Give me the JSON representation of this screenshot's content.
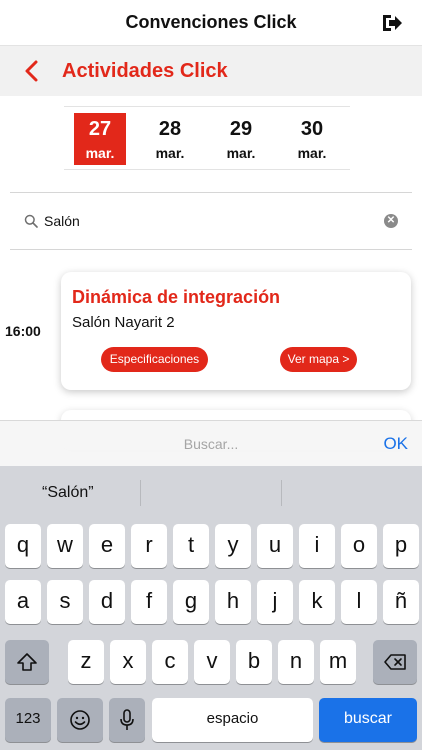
{
  "header": {
    "title": "Convenciones Click",
    "logout_icon": "logout-icon"
  },
  "section": {
    "title": "Actividades Click",
    "back_icon": "chevron-left-icon"
  },
  "dates": [
    {
      "day": "27",
      "month": "mar.",
      "selected": true
    },
    {
      "day": "28",
      "month": "mar.",
      "selected": false
    },
    {
      "day": "29",
      "month": "mar.",
      "selected": false
    },
    {
      "day": "30",
      "month": "mar.",
      "selected": false
    }
  ],
  "search": {
    "value": "Salón",
    "clear_icon": "clear-icon"
  },
  "activity": {
    "time": "16:00",
    "title": "Dinámica de integración",
    "location": "Salón Nayarit 2",
    "spec_label": "Especificaciones",
    "map_label": "Ver mapa >"
  },
  "accessory": {
    "placeholder": "Buscar...",
    "ok_label": "OK"
  },
  "keyboard": {
    "suggestion": "“Salón”",
    "row1": [
      "q",
      "w",
      "e",
      "r",
      "t",
      "y",
      "u",
      "i",
      "o",
      "p"
    ],
    "row2": [
      "a",
      "s",
      "d",
      "f",
      "g",
      "h",
      "j",
      "k",
      "l",
      "ñ"
    ],
    "row3": [
      "z",
      "x",
      "c",
      "v",
      "b",
      "n",
      "m"
    ],
    "numbers_label": "123",
    "space_label": "espacio",
    "go_label": "buscar"
  },
  "colors": {
    "accent": "#e2281a",
    "link": "#1a72e8"
  }
}
